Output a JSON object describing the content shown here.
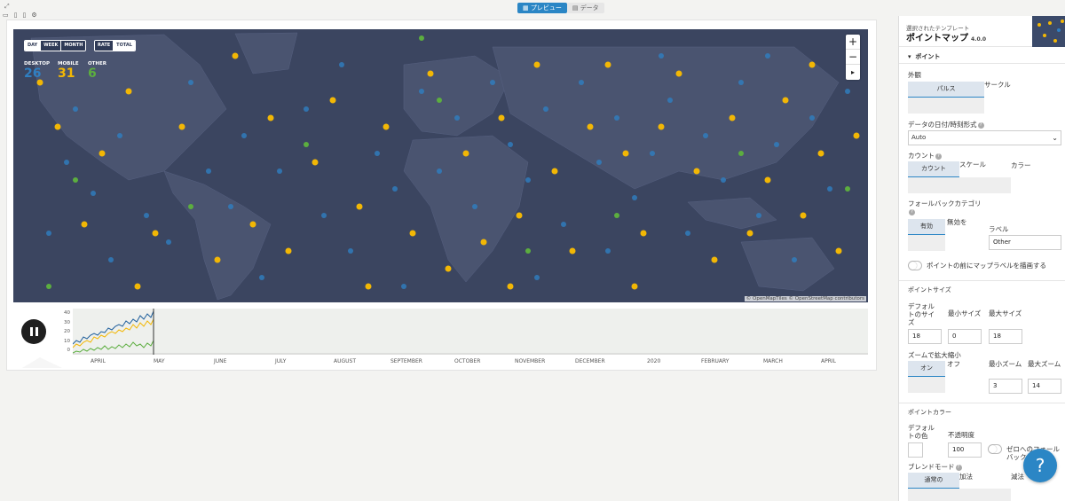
{
  "topbar": {
    "tabs": [
      {
        "label": "プレビュー",
        "icon": "chart-icon",
        "active": true
      },
      {
        "label": "データ",
        "icon": "table-icon",
        "active": false
      }
    ]
  },
  "map": {
    "period_buttons": [
      "DAY",
      "WEEK",
      "MONTH"
    ],
    "mode_buttons": [
      "RATE",
      "TOTAL"
    ],
    "stats": [
      {
        "label": "DESKTOP",
        "value": "26",
        "color": "#2f7fc2"
      },
      {
        "label": "MOBILE",
        "value": "31",
        "color": "#f2b705"
      },
      {
        "label": "OTHER",
        "value": "6",
        "color": "#5cae3f"
      }
    ],
    "zoom_in": "+",
    "zoom_out": "−",
    "reset": "▸",
    "attribution": "© OpenMapTiles © OpenStreetMap contributors"
  },
  "timeline": {
    "y_ticks": [
      "40",
      "30",
      "20",
      "10",
      "0"
    ],
    "months": [
      "APRIL",
      "MAY",
      "JUNE",
      "JULY",
      "AUGUST",
      "SEPTEMBER",
      "OCTOBER",
      "NOVEMBER",
      "DECEMBER",
      "2020",
      "FEBRUARY",
      "MARCH",
      "APRIL"
    ]
  },
  "sidebar": {
    "selected_template_label": "選択されたテンプレート",
    "template_name": "ポイントマップ",
    "version": "4.0.0",
    "section_points": "ポイント",
    "appearance_label": "外観",
    "appearance_pulse": "パルス",
    "appearance_circle": "サークル",
    "date_format_label": "データの日付/時刻形式",
    "date_format_value": "Auto",
    "count_label": "カウント",
    "count_opt1": "カウント",
    "count_opt2": "スケール",
    "count_opt3": "カラー",
    "fallback_label": "フォールバックカテゴリ",
    "fallback_on": "有効",
    "fallback_off": "無効を",
    "fallback_label_label": "ラベル",
    "fallback_label_value": "Other",
    "draw_labels_text": "ポイントの前にマップラベルを描画する",
    "section_size": "ポイントサイズ",
    "default_size_label": "デフォルトのサイズ",
    "min_size_label": "最小サイズ",
    "max_size_label": "最大サイズ",
    "default_size": "18",
    "min_size": "0",
    "max_size": "18",
    "zoom_scale_label": "ズームで拡大縮小",
    "zoom_on": "オン",
    "zoom_off": "オフ",
    "min_zoom_label": "最小ズーム",
    "max_zoom_label": "最大ズーム",
    "min_zoom": "3",
    "max_zoom": "14",
    "section_color": "ポイントカラー",
    "default_color_label": "デフォルトの色",
    "opacity_label": "不透明度",
    "opacity": "100",
    "zero_fallback_label": "ゼロへのフォールバック",
    "blend_label": "ブレンドモード",
    "blend_normal": "通常の",
    "blend_add": "加法",
    "blend_sub": "減法"
  },
  "help": "?"
}
